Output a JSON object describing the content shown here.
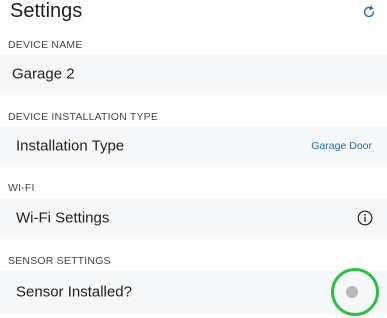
{
  "header": {
    "title": "Settings",
    "refresh_icon": "refresh-icon"
  },
  "sections": {
    "device_name": {
      "label": "DEVICE NAME",
      "value": "Garage 2"
    },
    "installation": {
      "label": "DEVICE INSTALLATION TYPE",
      "row_label": "Installation Type",
      "row_value": "Garage Door"
    },
    "wifi": {
      "label": "WI-FI",
      "row_label": "Wi-Fi Settings",
      "icon": "info-icon"
    },
    "sensor": {
      "label": "SENSOR SETTINGS",
      "row_label": "Sensor Installed?",
      "toggle_on": false
    }
  },
  "colors": {
    "accent": "#2b6ca3",
    "row_bg": "#f6f7f9",
    "highlight_ring": "#2fbf45",
    "toggle_knob": "#b9b9b9"
  }
}
